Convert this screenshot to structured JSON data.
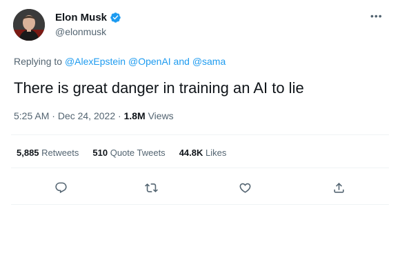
{
  "author": {
    "display_name": "Elon Musk",
    "handle": "@elonmusk",
    "verified": true,
    "avatar": "avatar-photo"
  },
  "reply_context": {
    "prefix": "Replying to ",
    "mentions": [
      "@AlexEpstein",
      "@OpenAI"
    ],
    "joiner": " and ",
    "last_mention": "@sama"
  },
  "tweet": {
    "text": "There is great danger in training an AI to lie"
  },
  "meta": {
    "time": "5:25 AM",
    "separator": "·",
    "date": "Dec 24, 2022",
    "views_count": "1.8M",
    "views_label": "Views"
  },
  "stats": {
    "retweets_count": "5,885",
    "retweets_label": "Retweets",
    "quotes_count": "510",
    "quotes_label": "Quote Tweets",
    "likes_count": "44.8K",
    "likes_label": "Likes"
  },
  "icons": {
    "more": "more-icon",
    "reply": "reply-icon",
    "retweet": "retweet-icon",
    "like": "like-icon",
    "share": "share-icon",
    "verified": "verified-badge-icon"
  },
  "colors": {
    "accent": "#1d9bf0",
    "text": "#0f1419",
    "secondary": "#536471",
    "divider": "#eff3f4"
  }
}
